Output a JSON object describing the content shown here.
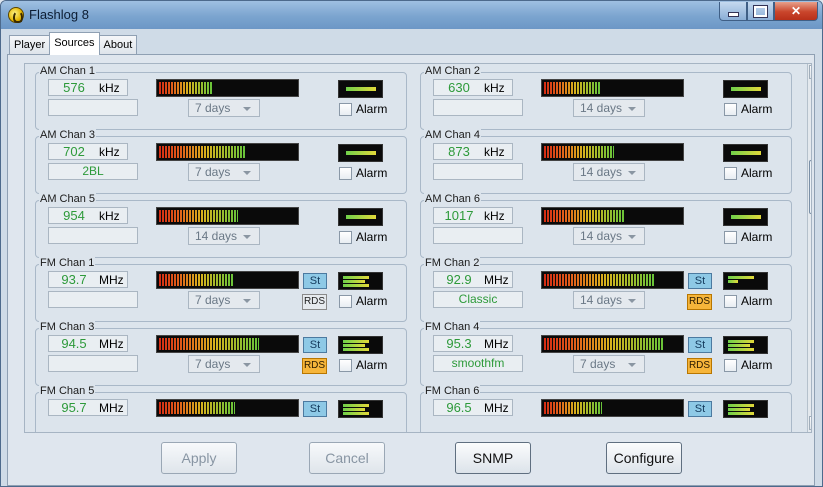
{
  "window": {
    "title": "Flashlog 8"
  },
  "tabs": [
    {
      "label": "Player"
    },
    {
      "label": "Sources"
    },
    {
      "label": "About"
    }
  ],
  "active_tab": "Sources",
  "channels": [
    {
      "title": "AM Chan 1",
      "freq": "576",
      "unit": "kHz",
      "label": "",
      "period": "7 days",
      "alarm": "Alarm",
      "level": 0.38,
      "signal_bars": 1
    },
    {
      "title": "AM Chan 2",
      "freq": "630",
      "unit": "kHz",
      "label": "",
      "period": "14 days",
      "alarm": "Alarm",
      "level": 0.4,
      "signal_bars": 1
    },
    {
      "title": "AM Chan 3",
      "freq": "702",
      "unit": "kHz",
      "label": "2BL",
      "period": "7 days",
      "alarm": "Alarm",
      "level": 0.62,
      "signal_bars": 1
    },
    {
      "title": "AM Chan 4",
      "freq": "873",
      "unit": "kHz",
      "label": "",
      "period": "14 days",
      "alarm": "Alarm",
      "level": 0.5,
      "signal_bars": 1
    },
    {
      "title": "AM Chan 5",
      "freq": "954",
      "unit": "kHz",
      "label": "",
      "period": "14 days",
      "alarm": "Alarm",
      "level": 0.57,
      "signal_bars": 1
    },
    {
      "title": "AM Chan 6",
      "freq": "1017",
      "unit": "kHz",
      "label": "",
      "period": "14 days",
      "alarm": "Alarm",
      "level": 0.58,
      "signal_bars": 1
    },
    {
      "title": "FM Chan 1",
      "freq": "93.7",
      "unit": "MHz",
      "label": "",
      "period": "7 days",
      "alarm": "Alarm",
      "level": 0.54,
      "st": "St",
      "rds": "RDS",
      "rds_on": false,
      "signal_bars": 3
    },
    {
      "title": "FM Chan 2",
      "freq": "92.9",
      "unit": "MHz",
      "label": "Classic",
      "period": "14 days",
      "alarm": "Alarm",
      "level": 0.8,
      "st": "St",
      "rds": "RDS",
      "rds_on": true,
      "signal_bars": 2
    },
    {
      "title": "FM Chan 3",
      "freq": "94.5",
      "unit": "MHz",
      "label": "",
      "period": "7 days",
      "alarm": "Alarm",
      "level": 0.72,
      "st": "St",
      "rds": "RDS",
      "rds_on": true,
      "signal_bars": 3
    },
    {
      "title": "FM Chan 4",
      "freq": "95.3",
      "unit": "MHz",
      "label": "smoothfm",
      "period": "7 days",
      "alarm": "Alarm",
      "level": 0.86,
      "st": "St",
      "rds": "RDS",
      "rds_on": true,
      "signal_bars": 3
    },
    {
      "title": "FM Chan 5",
      "freq": "95.7",
      "unit": "MHz",
      "label": "",
      "period": "",
      "alarm": "",
      "level": 0.55,
      "st": "St",
      "signal_bars": 3
    },
    {
      "title": "FM Chan 6",
      "freq": "96.5",
      "unit": "MHz",
      "label": "",
      "period": "",
      "alarm": "",
      "level": 0.42,
      "st": "St",
      "signal_bars": 3
    }
  ],
  "footer": {
    "apply": "Apply",
    "cancel": "Cancel",
    "snmp": "SNMP",
    "configure": "Configure"
  },
  "colors": {
    "value_text": "#2d9a3a",
    "rds_active": "#f6b53a",
    "stereo": "#8ec9e6"
  }
}
